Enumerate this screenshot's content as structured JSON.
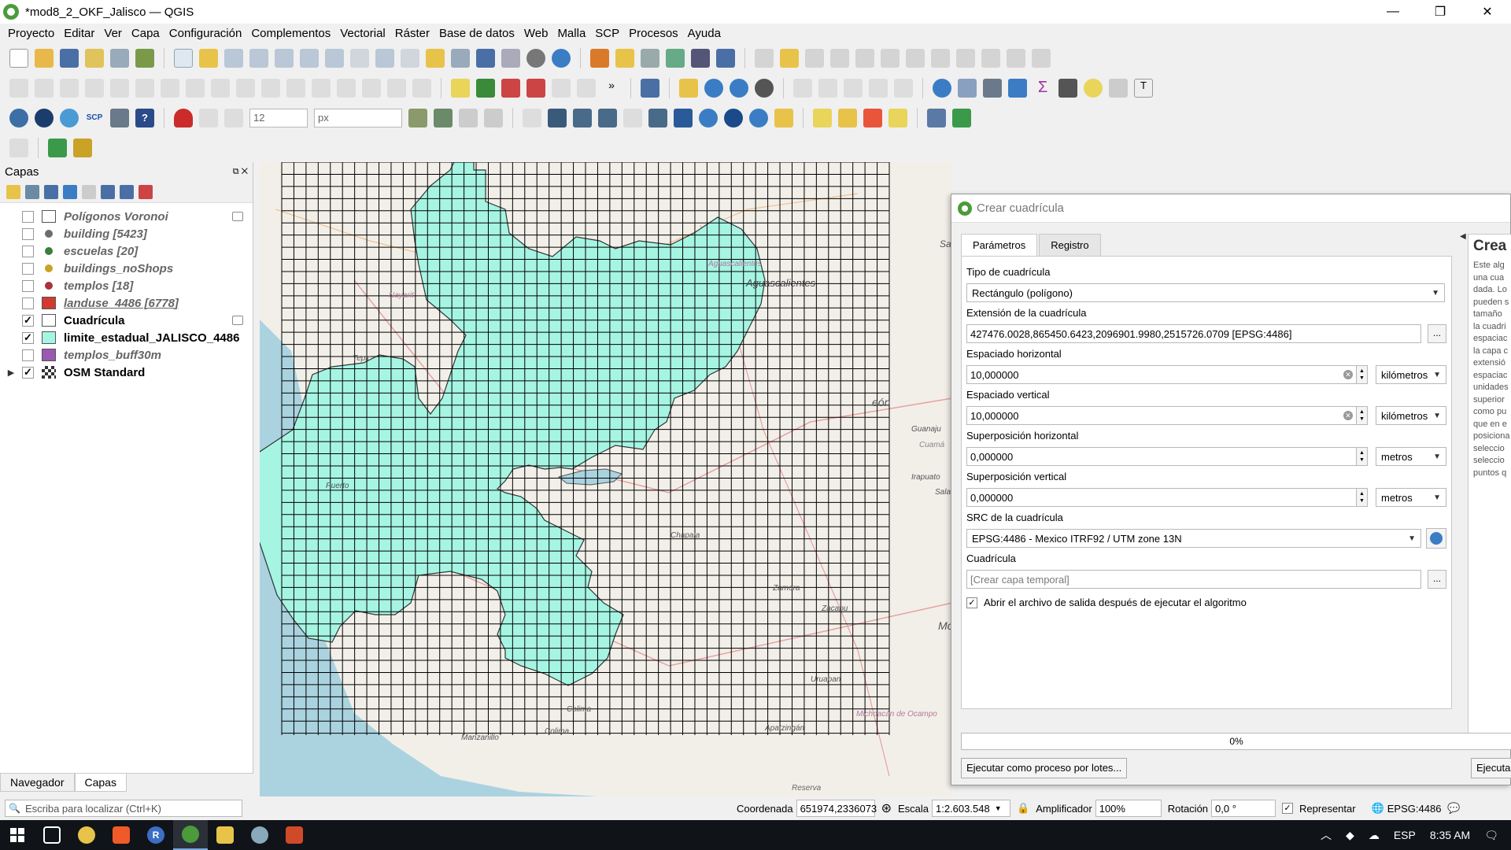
{
  "window": {
    "title": "*mod8_2_OKF_Jalisco — QGIS",
    "controls": [
      "—",
      "❐",
      "✕"
    ]
  },
  "menubar": [
    "Proyecto",
    "Editar",
    "Ver",
    "Capa",
    "Configuración",
    "Complementos",
    "Vectorial",
    "Ráster",
    "Base de datos",
    "Web",
    "Malla",
    "SCP",
    "Procesos",
    "Ayuda"
  ],
  "toolbar3": {
    "font_size": "12",
    "unit": "px",
    "scp_label": "SCP"
  },
  "layers_panel": {
    "title": "Capas",
    "layers": [
      {
        "name": "Polígonos Voronoi",
        "checked": false,
        "symbol": "square",
        "color": "#ffffff",
        "style": "dim",
        "indicator": true
      },
      {
        "name": "building [5423]",
        "checked": false,
        "symbol": "dot",
        "color": "#6d6d6d",
        "style": "dim",
        "indicator": false
      },
      {
        "name": "escuelas [20]",
        "checked": false,
        "symbol": "dot",
        "color": "#3b7d3b",
        "style": "dim",
        "indicator": false
      },
      {
        "name": "buildings_noShops",
        "checked": false,
        "symbol": "dot",
        "color": "#c9a227",
        "style": "dim",
        "indicator": false
      },
      {
        "name": "templos [18]",
        "checked": false,
        "symbol": "dot",
        "color": "#a8323e",
        "style": "dim",
        "indicator": false
      },
      {
        "name": "landuse_4486 [6778]",
        "checked": false,
        "symbol": "square",
        "color": "#d23a2f",
        "style": "dim underline",
        "indicator": false
      },
      {
        "name": "Cuadrícula",
        "checked": true,
        "symbol": "square",
        "color": "#ffffff",
        "style": "on",
        "indicator": true
      },
      {
        "name": "limite_estadual_JALISCO_4486",
        "checked": true,
        "symbol": "square",
        "color": "#a6f5e3",
        "style": "on",
        "indicator": false
      },
      {
        "name": "templos_buff30m",
        "checked": false,
        "symbol": "square",
        "color": "#9a5ab0",
        "style": "dim",
        "indicator": false
      },
      {
        "name": "OSM Standard",
        "checked": true,
        "symbol": "raster",
        "color": "#333333",
        "style": "on",
        "indicator": false
      }
    ],
    "tabs": [
      "Navegador",
      "Capas"
    ]
  },
  "map": {
    "labels": [
      "Aguascalientes",
      "Aguascalientes",
      "Guanaju",
      "Cuamá",
      "Salam",
      "Irapuato",
      "Zamora",
      "Uruapan",
      "Apatzingán",
      "Colima",
      "Colima",
      "Puerto",
      "Tepic",
      "Nayarit",
      "Chapala",
      "Mo",
      "eón",
      "Sa",
      "Zacapu",
      "Reserva",
      "Michoacán de Ocampo",
      "Manzanillo"
    ],
    "colors": {
      "background": "#f2efe9",
      "state_fill": "#a6f5e3",
      "sea": "#aad3df",
      "grid": "#000000"
    }
  },
  "dialog": {
    "title": "Crear cuadrícula",
    "tabs": [
      "Parámetros",
      "Registro"
    ],
    "fields": {
      "grid_type_label": "Tipo de cuadrícula",
      "grid_type_value": "Rectángulo (polígono)",
      "extent_label": "Extensión de la cuadrícula",
      "extent_value": "427476.0028,865450.6423,2096901.9980,2515726.0709 [EPSG:4486]",
      "h_spacing_label": "Espaciado horizontal",
      "h_spacing_value": "10,000000",
      "h_spacing_unit": "kilómetros",
      "v_spacing_label": "Espaciado vertical",
      "v_spacing_value": "10,000000",
      "v_spacing_unit": "kilómetros",
      "h_overlay_label": "Superposición horizontal",
      "h_overlay_value": "0,000000",
      "h_overlay_unit": "metros",
      "v_overlay_label": "Superposición vertical",
      "v_overlay_value": "0,000000",
      "v_overlay_unit": "metros",
      "crs_label": "SRC de la cuadrícula",
      "crs_value": "EPSG:4486 - Mexico ITRF92 / UTM zone 13N",
      "output_label": "Cuadrícula",
      "output_placeholder": "[Crear capa temporal]",
      "open_output_label": "Abrir el archivo de salida después de ejecutar el algoritmo",
      "dots": "..."
    },
    "help": {
      "title": "Crea",
      "lines": [
        "Este alg",
        "una cua",
        "dada. Lo",
        "pueden s",
        "tamaño",
        "la cuadri",
        "espaciac",
        "la capa c",
        "extensió",
        "espaciac",
        "unidades",
        "superior",
        "como pu",
        "que en e",
        "posiciona",
        "seleccio",
        "seleccio",
        "puntos q"
      ]
    },
    "progress": "0%",
    "batch_button": "Ejecutar como proceso por lotes...",
    "run_button": "Ejecutar"
  },
  "statusbar": {
    "locate_placeholder": "Escriba para localizar (Ctrl+K)",
    "coord_label": "Coordenada",
    "coord_value": "651974,2336073",
    "scale_label": "Escala",
    "scale_value": "1:2.603.548",
    "magnifier_label": "Amplificador",
    "magnifier_value": "100%",
    "rotation_label": "Rotación",
    "rotation_value": "0,0 °",
    "render_label": "Representar",
    "crs": "EPSG:4486"
  },
  "taskbar": {
    "lang": "ESP",
    "time": "8:35 AM",
    "r_label": "R"
  }
}
